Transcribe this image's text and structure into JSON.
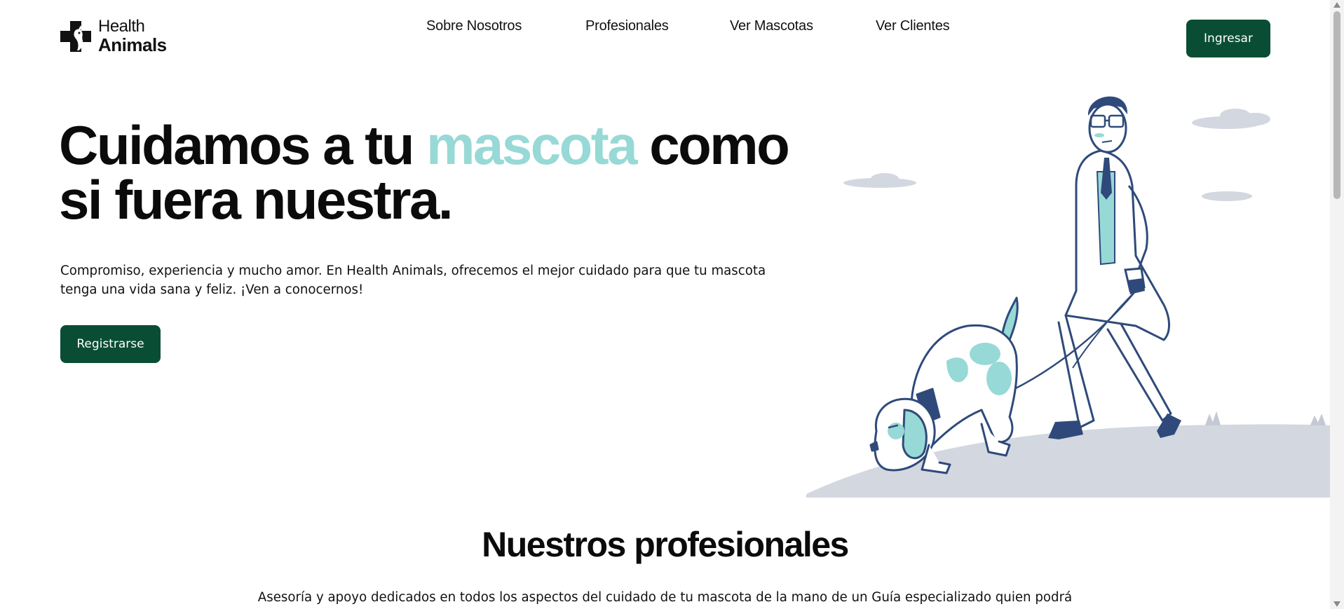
{
  "header": {
    "logo": {
      "line1": "Health",
      "line2": "Animals"
    },
    "nav": [
      {
        "label": "Sobre Nosotros"
      },
      {
        "label": "Profesionales"
      },
      {
        "label": "Ver Mascotas"
      },
      {
        "label": "Ver Clientes"
      }
    ],
    "login_label": "Ingresar"
  },
  "hero": {
    "title_part1": "Cuidamos a tu ",
    "title_accent": "mascota",
    "title_part2": " como si fuera nuestra.",
    "subtitle": "Compromiso, experiencia y mucho amor. En Health Animals, ofrecemos el mejor cuidado para que tu mascota tenga una vida sana y feliz. ¡Ven a conocernos!",
    "register_label": "Registrarse"
  },
  "professionals": {
    "title": "Nuestros profesionales",
    "subtitle": "Asesoría y apoyo dedicados en todos los aspectos del cuidado de tu mascota de la mano de un Guía especializado quien podrá"
  },
  "colors": {
    "primary": "#0a4d35",
    "accent": "#97d9d6",
    "illustration_line": "#2f4a7a",
    "ground": "#d3d7df"
  }
}
